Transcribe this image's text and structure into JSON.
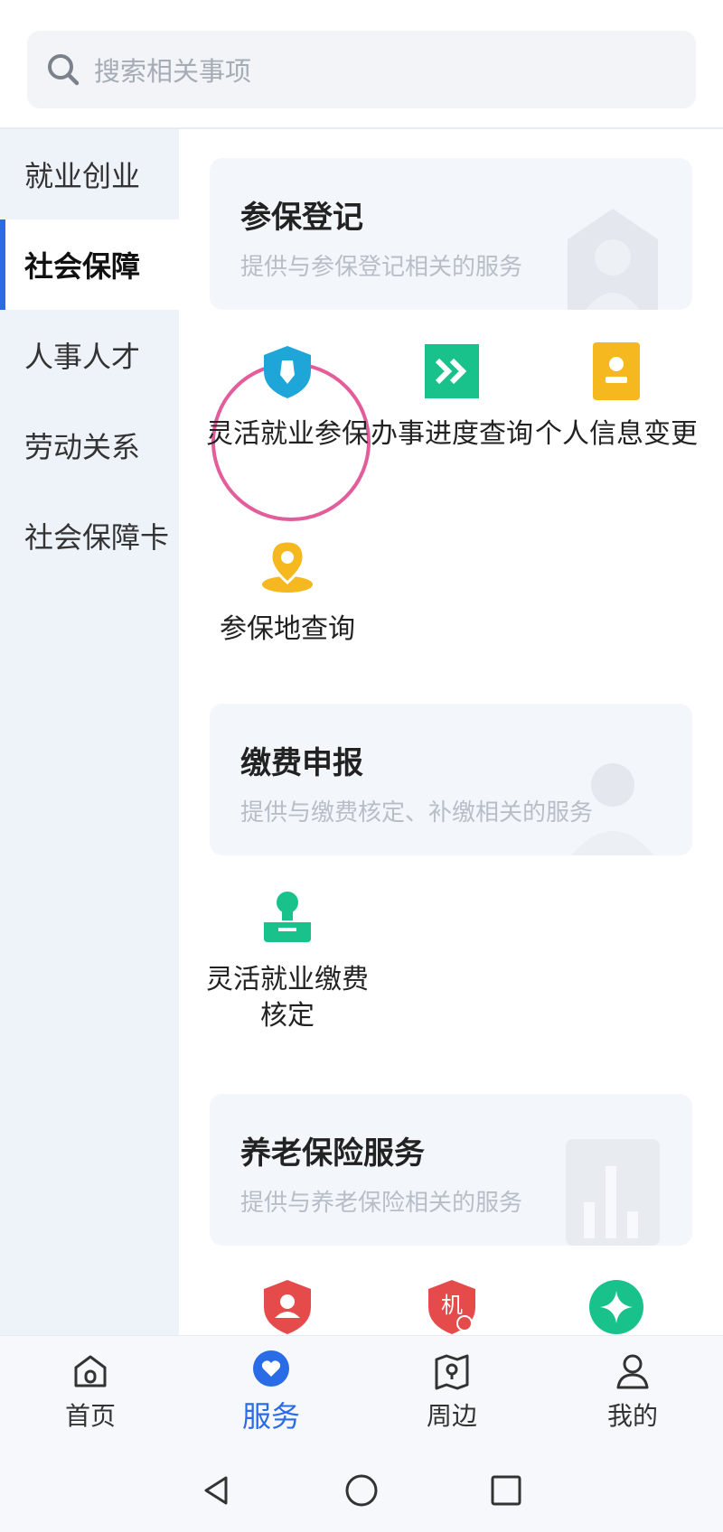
{
  "search": {
    "placeholder": "搜索相关事项"
  },
  "sidebar": {
    "items": [
      {
        "label": "就业创业"
      },
      {
        "label": "社会保障"
      },
      {
        "label": "人事人才"
      },
      {
        "label": "劳动关系"
      },
      {
        "label": "社会保障卡"
      }
    ],
    "active_index": 1
  },
  "sections": [
    {
      "title": "参保登记",
      "desc": "提供与参保登记相关的服务",
      "services": [
        {
          "label": "灵活就业参保",
          "icon": "shield-icon"
        },
        {
          "label": "办事进度查询",
          "icon": "double-chevron-icon"
        },
        {
          "label": "个人信息变更",
          "icon": "id-card-icon"
        },
        {
          "label": "参保地查询",
          "icon": "location-pin-icon"
        }
      ]
    },
    {
      "title": "缴费申报",
      "desc": "提供与缴费核定、补缴相关的服务",
      "services": [
        {
          "label": "灵活就业缴费核定",
          "icon": "stamp-icon"
        }
      ]
    },
    {
      "title": "养老保险服务",
      "desc": "提供与养老保险相关的服务",
      "services": [
        {
          "label": "",
          "icon": "shield-person-icon"
        },
        {
          "label": "机",
          "icon": "agency-shield-icon"
        },
        {
          "label": "",
          "icon": "sparkle-icon"
        }
      ]
    }
  ],
  "nav": {
    "items": [
      {
        "label": "首页",
        "icon": "home-icon"
      },
      {
        "label": "服务",
        "icon": "heart-service-icon"
      },
      {
        "label": "周边",
        "icon": "map-pin-icon"
      },
      {
        "label": "我的",
        "icon": "user-icon"
      }
    ],
    "active_index": 1
  },
  "colors": {
    "accent": "#2a6be6",
    "teal": "#1ea6d8",
    "green": "#19c28a",
    "yellow": "#f5b81f",
    "red": "#e64b4b",
    "annotation": "#e35d9b"
  }
}
